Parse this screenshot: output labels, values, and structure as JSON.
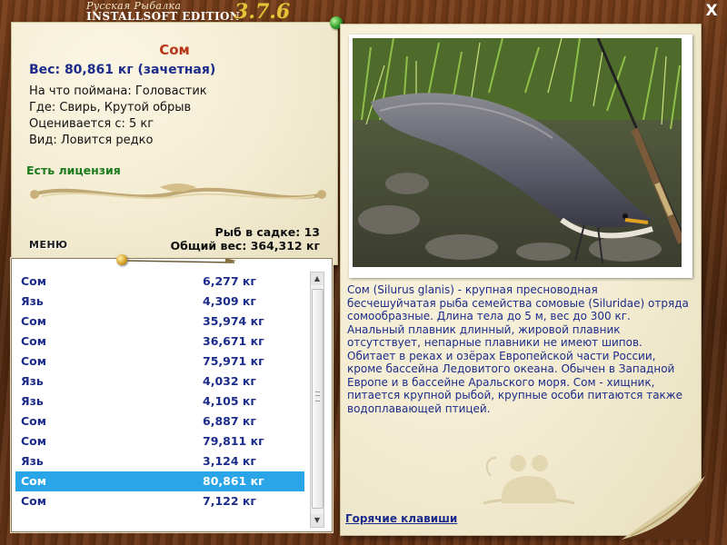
{
  "app": {
    "brand_top": "Русская Рыбалка",
    "brand_bottom": "INSTALLSOFT EDITION",
    "version": "3.7.6",
    "close_symbol": "X"
  },
  "fish": {
    "name": "Сом",
    "weight_line": "Вес: 80,861 кг (зачетная)",
    "bait_line": "На что поймана: Головастик",
    "place_line": "Где: Свирь, Крутой обрыв",
    "rated_line": "Оценивается с: 5 кг",
    "kind_line": "Вид: Ловится редко",
    "license": "Есть лицензия"
  },
  "menu_label": "МЕНЮ",
  "stats": {
    "fish_count": "Рыб в садке: 13",
    "total_weight": "Общий вес: 364,312 кг"
  },
  "catch_list": [
    {
      "name": "Сом",
      "weight": "6,277 кг"
    },
    {
      "name": "Язь",
      "weight": "4,309 кг"
    },
    {
      "name": "Сом",
      "weight": "35,974 кг"
    },
    {
      "name": "Сом",
      "weight": "36,671 кг"
    },
    {
      "name": "Сом",
      "weight": "75,971 кг"
    },
    {
      "name": "Язь",
      "weight": "4,032 кг"
    },
    {
      "name": "Язь",
      "weight": "4,105 кг"
    },
    {
      "name": "Сом",
      "weight": "6,887 кг"
    },
    {
      "name": "Сом",
      "weight": "79,811 кг"
    },
    {
      "name": "Язь",
      "weight": "3,124 кг"
    },
    {
      "name": "Сом",
      "weight": "80,861 кг",
      "selected": true
    },
    {
      "name": "Сом",
      "weight": "7,122 кг"
    }
  ],
  "description": "Сом (Silurus glanis) - крупная пресноводная бесчешуйчатая рыба семейства сомовые (Siluridae) отряда сомообразные. Длина тела до 5 м, вес до 300 кг. Анальный плавник длинный, жировой плавник отсутствует, непарные плавники не имеют шипов. Обитает в реках и озёрах Европейской части России, кроме бассейна Ледовитого океана. Обычен в Западной Европе и в бассейне Аральского моря. Сом - хищник, питается крупной рыбой, крупные особи питаются также водоплавающей птицей.",
  "hotkeys_label": "Горячие клавиши",
  "colors": {
    "title_red": "#b8371a",
    "text_blue": "#1c2c8a",
    "license_green": "#1d7a1d",
    "selection_blue": "#2aa6e8",
    "parchment": "#f5efd7"
  },
  "icons": {
    "pin_green": "green-pushpin-icon",
    "pin_gold": "gold-pushpin-icon",
    "close": "close-icon",
    "emblem": "fisherman-emblem-icon"
  }
}
